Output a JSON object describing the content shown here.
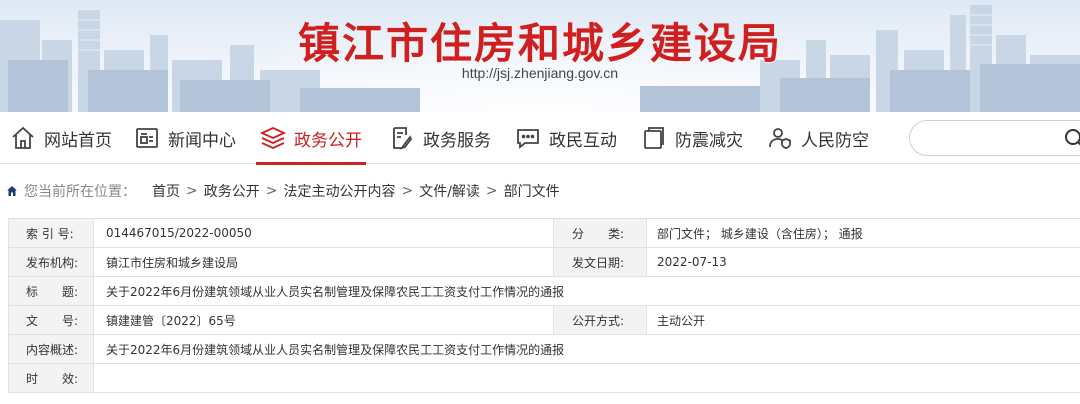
{
  "header": {
    "title": "镇江市住房和城乡建设局",
    "url": "http://jsj.zhenjiang.gov.cn"
  },
  "nav": {
    "items": [
      {
        "label": "网站首页",
        "icon": "home-icon",
        "active": false
      },
      {
        "label": "新闻中心",
        "icon": "news-icon",
        "active": false
      },
      {
        "label": "政务公开",
        "icon": "layers-icon",
        "active": true
      },
      {
        "label": "政务服务",
        "icon": "document-edit-icon",
        "active": false
      },
      {
        "label": "政民互动",
        "icon": "chat-icon",
        "active": false
      },
      {
        "label": "防震减灾",
        "icon": "panel-icon",
        "active": false
      },
      {
        "label": "人民防空",
        "icon": "person-shield-icon",
        "active": false
      }
    ],
    "search_placeholder": "",
    "active_color": "#cf1f1f"
  },
  "breadcrumb": {
    "prefix": "您当前所在位置：",
    "items": [
      "首页",
      "政务公开",
      "法定主动公开内容",
      "文件/解读",
      "部门文件"
    ],
    "separator": ">"
  },
  "info": {
    "index_label": "索 引 号:",
    "index_value": "014467015/2022-00050",
    "category_label": "分　　类:",
    "category_value": "部门文件；  城乡建设（含住房）；  通报",
    "publisher_label": "发布机构:",
    "publisher_value": "镇江市住房和城乡建设局",
    "date_label": "发文日期:",
    "date_value": "2022-07-13",
    "title_label": "标　　题:",
    "title_value": "关于2022年6月份建筑领域从业人员实名制管理及保障农民工工资支付工作情况的通报",
    "docno_label": "文　　号:",
    "docno_value": "镇建建管〔2022〕65号",
    "openmode_label": "公开方式:",
    "openmode_value": "主动公开",
    "summary_label": "内容概述:",
    "summary_value": "关于2022年6月份建筑领域从业人员实名制管理及保障农民工工资支付工作情况的通报",
    "validity_label": "时　　效:",
    "validity_value": ""
  }
}
